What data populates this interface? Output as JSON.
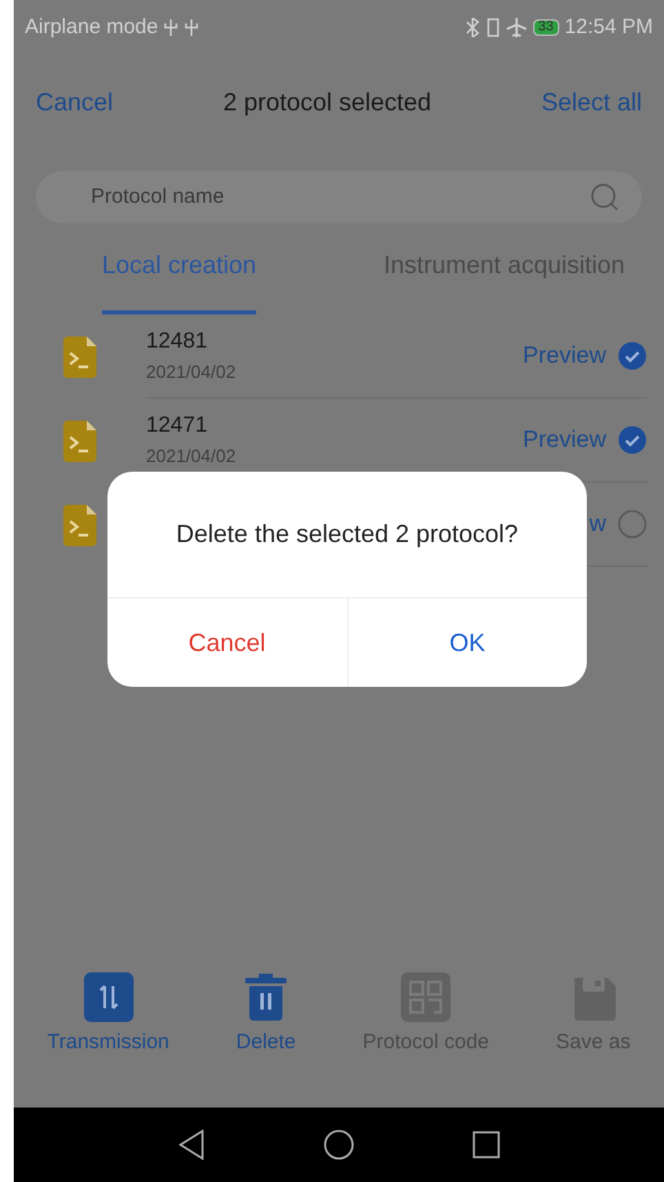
{
  "status_bar": {
    "left": "Airplane mode",
    "time": "12:54 PM",
    "battery": "33"
  },
  "header": {
    "cancel": "Cancel",
    "title": "2 protocol selected",
    "select_all": "Select all"
  },
  "search": {
    "placeholder": "Protocol name"
  },
  "tabs": [
    {
      "label": "Local creation",
      "selected": true
    },
    {
      "label": "Instrument acquisition",
      "selected": false
    }
  ],
  "protocols": [
    {
      "name": "12481",
      "date": "2021/04/02",
      "preview": "Preview",
      "selected": true
    },
    {
      "name": "12471",
      "date": "2021/04/02",
      "preview": "Preview",
      "selected": true
    },
    {
      "preview": "w",
      "selected": false
    }
  ],
  "dialog": {
    "message": "Delete the selected 2 protocol?",
    "buttons": [
      {
        "label": "Cancel",
        "kind": "cancel"
      },
      {
        "label": "OK",
        "kind": "ok"
      }
    ]
  },
  "toolbar": [
    {
      "label": "Transmission",
      "kind": "transfer",
      "disabled": false
    },
    {
      "label": "Delete",
      "kind": "trash",
      "disabled": false
    },
    {
      "label": "Protocol code",
      "kind": "qr",
      "disabled": true
    },
    {
      "label": "Save as",
      "kind": "save",
      "disabled": true
    }
  ]
}
